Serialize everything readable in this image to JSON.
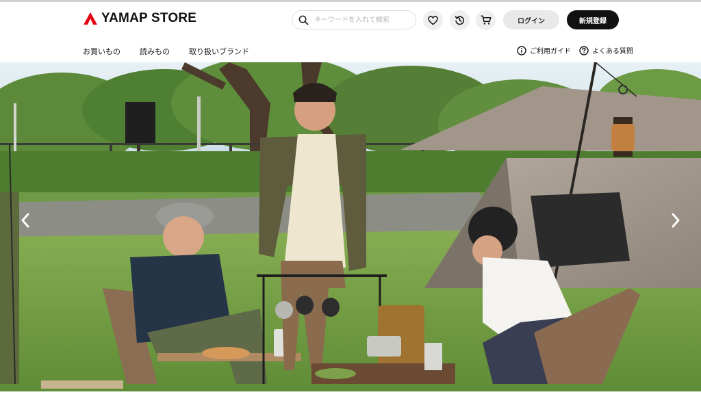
{
  "brand": {
    "name": "YAMAP STORE",
    "accent": "#e60012"
  },
  "search": {
    "placeholder": "キーワードを入れて検索"
  },
  "header_icons": [
    "heart-icon",
    "history-icon",
    "cart-icon"
  ],
  "auth": {
    "login": "ログイン",
    "signup": "新規登録"
  },
  "nav": [
    "お買いもの",
    "読みもの",
    "取り扱いブランド"
  ],
  "help": {
    "guide": "ご利用ガイド",
    "faq": "よくある質問"
  },
  "hero": {
    "prev_icon": "chevron-left-icon",
    "next_icon": "chevron-right-icon"
  }
}
